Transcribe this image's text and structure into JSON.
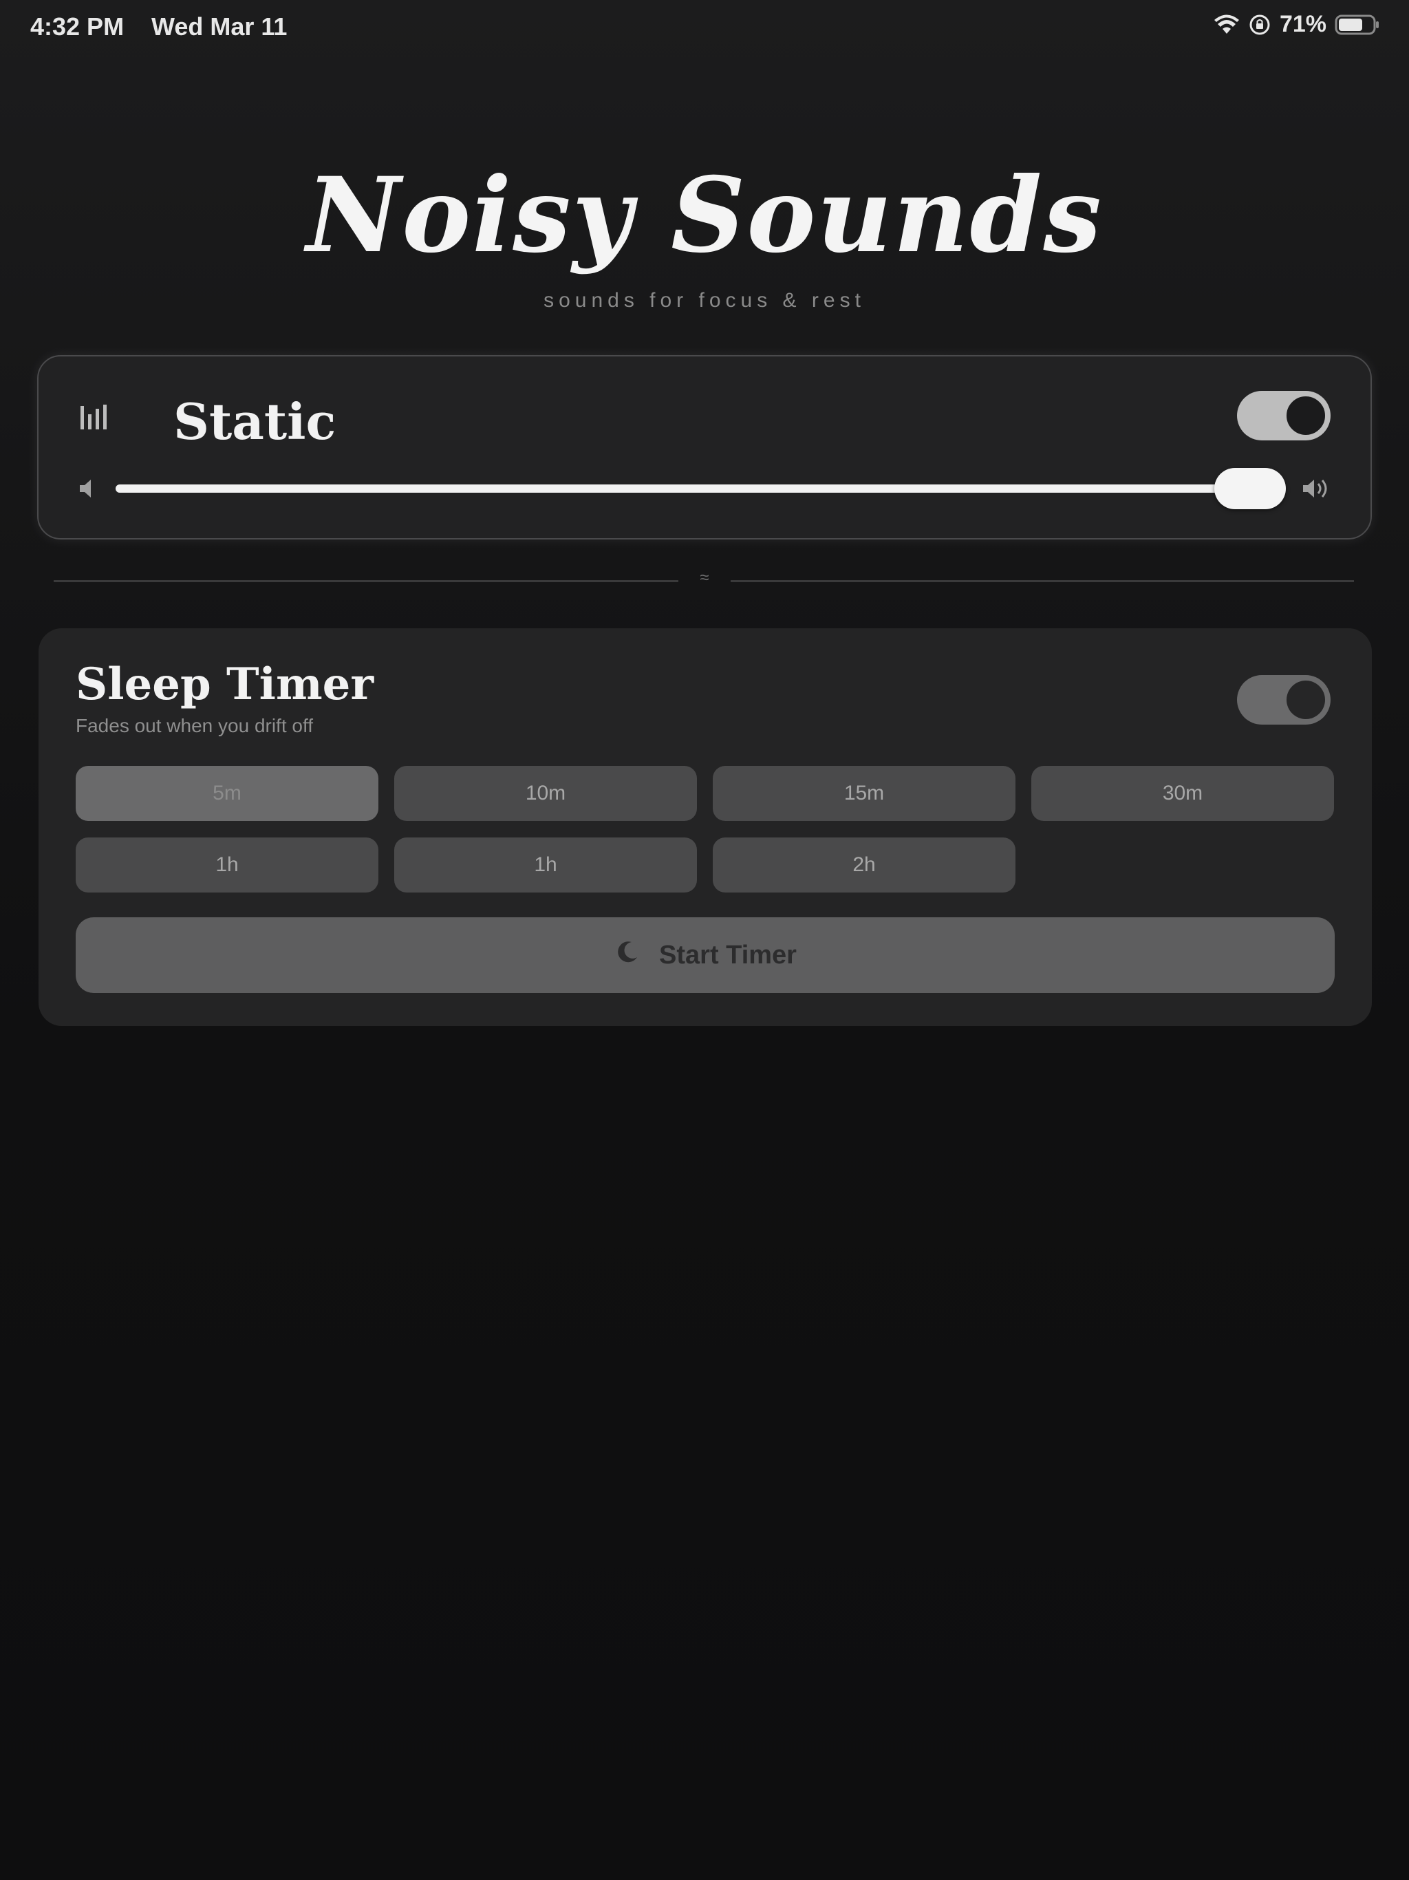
{
  "status_bar": {
    "time": "4:32 PM",
    "date": "Wed Mar 11",
    "battery_percent": "71%",
    "battery_level": 0.71,
    "icons": [
      "wifi-icon",
      "lock-rotation-icon",
      "battery-icon"
    ]
  },
  "header": {
    "title": "Noisy Sounds",
    "subtitle": "sounds for focus & rest"
  },
  "sound_card": {
    "name": "Static",
    "icon": "equalizer-icon",
    "enabled": true,
    "volume_level": 0.97,
    "volume_low_icon": "speaker-low-icon",
    "volume_high_icon": "speaker-high-icon"
  },
  "divider": {
    "glyph": "≈"
  },
  "sleep_timer": {
    "title": "Sleep Timer",
    "subtitle": "Fades out when you drift off",
    "enabled": false,
    "options": [
      "5m",
      "10m",
      "15m",
      "30m",
      "1h",
      "1h",
      "2h"
    ],
    "selected_index": 0,
    "start_label": "Start Timer",
    "start_icon": "moon-icon"
  },
  "colors": {
    "background": "#0f0f10",
    "card": "#222223",
    "accent": "#f2f2f2"
  }
}
